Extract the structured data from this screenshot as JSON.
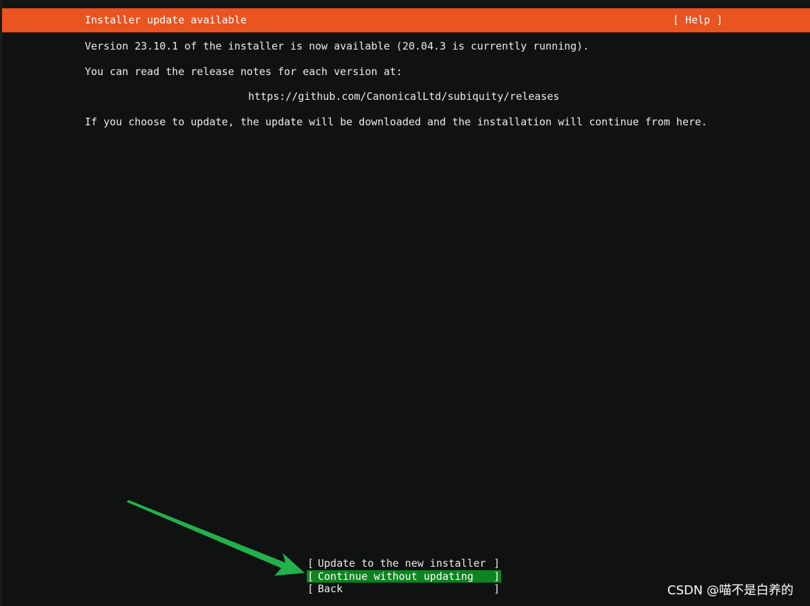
{
  "header": {
    "title": "Installer update available",
    "help_label": "[ Help ]"
  },
  "body": {
    "line1": "Version 23.10.1 of the installer is now available (20.04.3 is currently running).",
    "line2": "You can read the release notes for each version at:",
    "url": "https://github.com/CanonicalLtd/subiquity/releases",
    "line3": "If you choose to update, the update will be downloaded and the installation will continue from here."
  },
  "menu": {
    "items": [
      {
        "label": "Update to the new installer",
        "selected": false
      },
      {
        "label": "Continue without updating",
        "selected": true
      },
      {
        "label": "Back",
        "selected": false
      }
    ],
    "bracket_left": "[",
    "bracket_right": "]"
  },
  "watermark": "CSDN @喵不是白养的",
  "colors": {
    "header_bg": "#e95420",
    "selected_bg": "#0e8420",
    "arrow": "#22b14c",
    "background": "#101111"
  }
}
